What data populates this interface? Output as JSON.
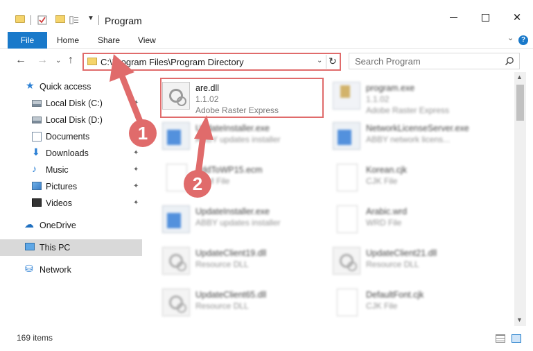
{
  "window": {
    "title": "Program"
  },
  "ribbon": {
    "tabs": [
      {
        "label": "File"
      },
      {
        "label": "Home"
      },
      {
        "label": "Share"
      },
      {
        "label": "View"
      }
    ]
  },
  "address": {
    "path": "C:\\Program Files\\Program Directory"
  },
  "search": {
    "placeholder": "Search Program"
  },
  "sidebar": {
    "items": [
      {
        "label": "Quick access",
        "icon": "star-icon"
      },
      {
        "label": "Local Disk (C:)",
        "icon": "drive-icon"
      },
      {
        "label": "Local Disk (D:)",
        "icon": "drive-icon"
      },
      {
        "label": "Documents",
        "icon": "documents-icon"
      },
      {
        "label": "Downloads",
        "icon": "download-icon"
      },
      {
        "label": "Music",
        "icon": "music-icon"
      },
      {
        "label": "Pictures",
        "icon": "pictures-icon"
      },
      {
        "label": "Videos",
        "icon": "videos-icon"
      },
      {
        "label": "OneDrive",
        "icon": "cloud-icon"
      },
      {
        "label": "This PC",
        "icon": "computer-icon"
      },
      {
        "label": "Network",
        "icon": "network-icon"
      }
    ]
  },
  "files": [
    {
      "name": "are.dll",
      "line1": "1.1.02",
      "line2": "Adobe Raster Express",
      "icon": "dll-gear-icon"
    },
    {
      "name": "program.exe",
      "line1": "1.1.02",
      "line2": "Adobe Raster Express",
      "icon": "program-icon"
    },
    {
      "name": "UpdateInstaller.exe",
      "line1": "ABBY updates installer",
      "line2": "",
      "icon": "installer-icon"
    },
    {
      "name": "NetworkLicenseServer.exe",
      "line1": "ABBY network licens...",
      "line2": "",
      "icon": "installer-icon"
    },
    {
      "name": "AddToWP15.ecm",
      "line1": "ECM File",
      "line2": "",
      "icon": "blank-file-icon"
    },
    {
      "name": "Korean.cjk",
      "line1": "CJK File",
      "line2": "",
      "icon": "blank-file-icon"
    },
    {
      "name": "UpdateInstaller.exe",
      "line1": "ABBY updates installer",
      "line2": "",
      "icon": "installer-icon"
    },
    {
      "name": "Arabic.wrd",
      "line1": "WRD File",
      "line2": "",
      "icon": "blank-file-icon"
    },
    {
      "name": "UpdateClient19.dll",
      "line1": "Resource DLL",
      "line2": "",
      "icon": "dll-gear-icon"
    },
    {
      "name": "UpdateClient21.dll",
      "line1": "Resource DLL",
      "line2": "",
      "icon": "dll-gear-icon"
    },
    {
      "name": "UpdateClient65.dll",
      "line1": "Resource DLL",
      "line2": "",
      "icon": "dll-gear-icon"
    },
    {
      "name": "DefaultFont.cjk",
      "line1": "CJK File",
      "line2": "",
      "icon": "blank-file-icon"
    }
  ],
  "status": {
    "items_count": "169 items"
  },
  "annotations": [
    {
      "label": "1"
    },
    {
      "label": "2"
    }
  ],
  "colors": {
    "accent": "#1979ca",
    "annotation": "#e06b6b",
    "selection": "#d9d9d9"
  }
}
